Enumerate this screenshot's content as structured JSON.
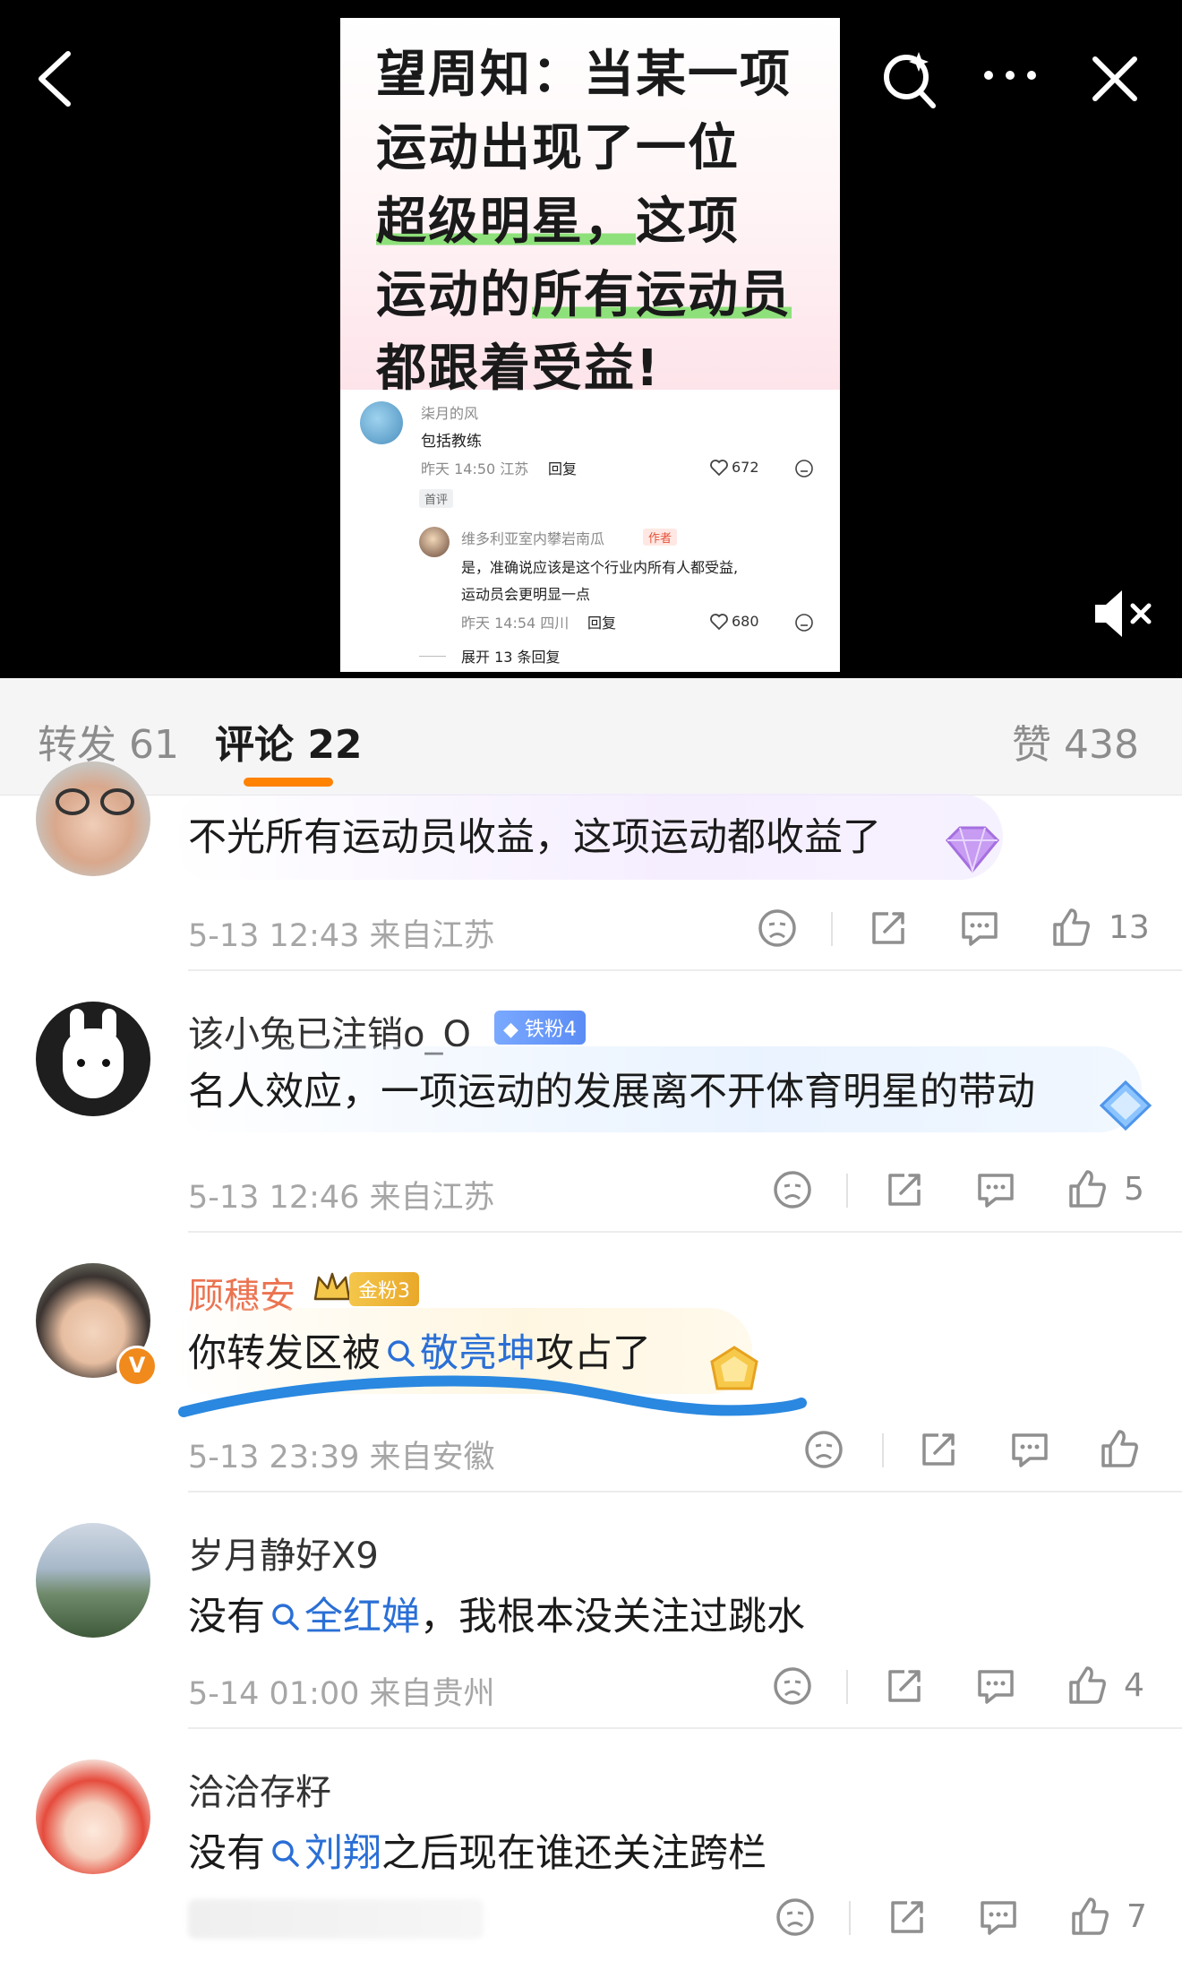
{
  "post_image": {
    "headline_lines": [
      "望周知：当某一项",
      "运动出现了一位",
      "超级明星，",
      "这项",
      "运动的",
      "所有运动员",
      "都跟着受益!"
    ],
    "embedded_comment": {
      "user": "柒月的风",
      "text": "包括教练",
      "meta": "昨天 14:50 江苏",
      "reply_label": "回复",
      "likes": "672",
      "tag": "首评"
    },
    "embedded_reply": {
      "user": "维多利亚室内攀岩南瓜",
      "author_tag": "作者",
      "text_line1": "是，准确说应该是这个行业内所有人都受益,",
      "text_line2": "运动员会更明显一点",
      "meta": "昨天 14:54 四川",
      "reply_label": "回复",
      "likes": "680"
    },
    "expand_label": "展开 13 条回复"
  },
  "tabs": {
    "repost": "转发 61",
    "comments": "评论 22",
    "likes": "赞 438"
  },
  "comments": [
    {
      "text": "不光所有运动员收益，这项运动都收益了",
      "meta": "5-13 12:43  来自江苏",
      "likes": "13"
    },
    {
      "user": "该小兔已注销o_O",
      "badge": "铁粉4",
      "text": "名人效应，一项运动的发展离不开体育明星的带动",
      "meta": "5-13 12:46  来自江苏",
      "likes": "5"
    },
    {
      "user": "顾穗安",
      "badge": "金粉3",
      "text_before": "你转发区被",
      "hashtag": "敬亮坤",
      "text_after": "攻占了",
      "meta": "5-13 23:39  来自安徽",
      "likes": ""
    },
    {
      "user": "岁月静好X9",
      "text_before": "没有",
      "hashtag": "全红婵",
      "text_after": "，我根本没关注过跳水",
      "meta": "5-14 01:00  来自贵州",
      "likes": "4"
    },
    {
      "user": "洽洽存籽",
      "text_before": "没有",
      "hashtag": "刘翔",
      "text_after": "之后现在谁还关注跨栏",
      "meta": "",
      "likes": "7"
    }
  ],
  "colors": {
    "accent_orange": "#ff8200",
    "link_blue": "#2a6fd6",
    "vip_name": "#eb7350",
    "annotation_stroke": "#2a88e0"
  },
  "icons": [
    "back-icon",
    "ai-search-icon",
    "more-icon",
    "close-icon",
    "mute-icon",
    "dislike-icon",
    "share-icon",
    "comment-icon",
    "thumbs-up-icon"
  ]
}
